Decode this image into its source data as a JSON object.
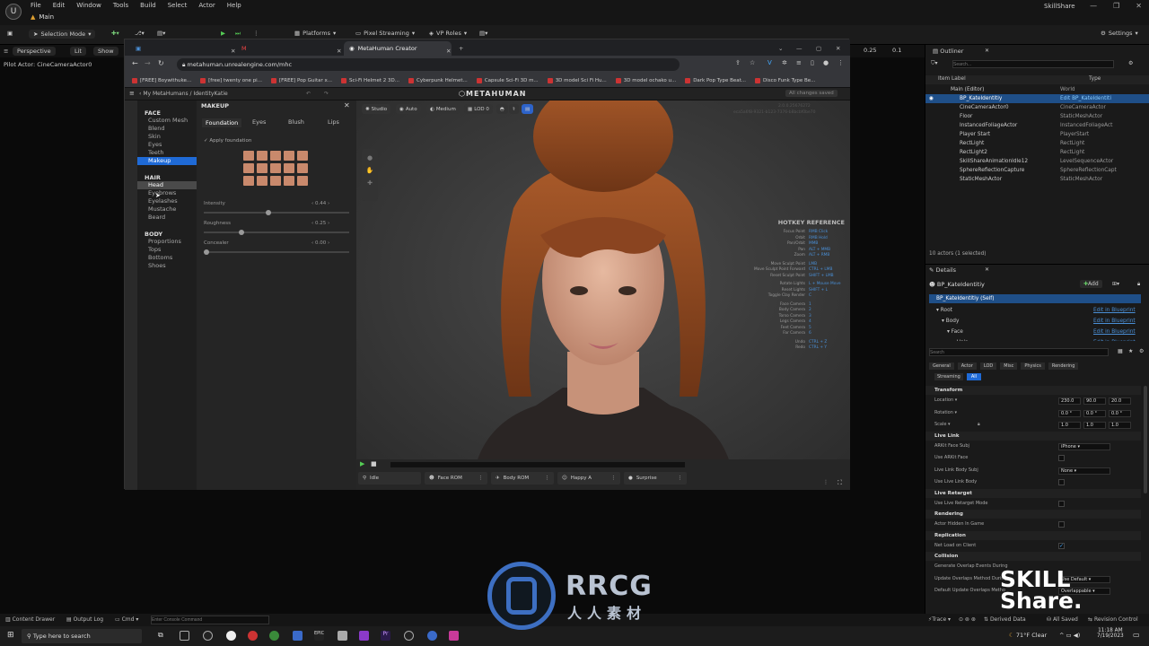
{
  "ue": {
    "menus": [
      "File",
      "Edit",
      "Window",
      "Tools",
      "Build",
      "Select",
      "Actor",
      "Help"
    ],
    "main_tab": "Main",
    "project": "SkillShare",
    "selection_mode": "Selection Mode",
    "platforms": "Platforms",
    "pixel_streaming": "Pixel Streaming",
    "vp_roles": "VP Roles",
    "settings": "Settings",
    "perspective": "Perspective",
    "lit": "Lit",
    "show": "Show",
    "pilot_actor": "Pilot Actor: CineCameraActor0",
    "vp_value1": "0.25",
    "vp_value2": "0.1"
  },
  "browser": {
    "tab_active": "MetaHuman Creator",
    "url": "metahuman.unrealengine.com/mhc",
    "bookmarks": [
      "[FREE] Boywithuke...",
      "[free] twenty one pi...",
      "[FREE] Pop Guitar x...",
      "Sci-Fi Helmet 2 3D...",
      "Cyberpunk Helmet...",
      "Capsule Sci-Fi 3D m...",
      "3D model Sci Fi Hu...",
      "3D model ochako u...",
      "Dark Pop Type Beat...",
      "Disco Funk Type Be..."
    ]
  },
  "mh": {
    "breadcrumb": "My MetaHumans / IdentityKatie",
    "logo": "METAHUMAN",
    "save_status": "All changes saved",
    "version": "2.0.0.25676272",
    "build_id": "eca5a6f8-9321-b123-7376-b8bcbf0be70",
    "nav": {
      "face_header": "FACE",
      "face": [
        "Custom Mesh",
        "Blend",
        "Skin",
        "Eyes",
        "Teeth",
        "Makeup"
      ],
      "hair_header": "HAIR",
      "hair": [
        "Head",
        "Eyebrows",
        "Eyelashes",
        "Mustache",
        "Beard"
      ],
      "body_header": "BODY",
      "body": [
        "Proportions",
        "Tops",
        "Bottoms",
        "Shoes"
      ]
    },
    "makeup": {
      "title": "MAKEUP",
      "tabs": [
        "Foundation",
        "Eyes",
        "Blush",
        "Lips"
      ],
      "apply": "Apply foundation",
      "sliders": [
        {
          "label": "Intensity",
          "value": "0.44",
          "fraction": 0.44
        },
        {
          "label": "Roughness",
          "value": "0.25",
          "fraction": 0.25
        },
        {
          "label": "Concealer",
          "value": "0.00",
          "fraction": 0.0
        }
      ]
    },
    "viewport_chips": [
      "Studio",
      "Auto",
      "Medium",
      "LOD 0"
    ],
    "hotkey_title": "HOTKEY REFERENCE",
    "hotkeys": [
      [
        "Focus Point",
        "RMB Click"
      ],
      [
        "Orbit",
        "RMB Hold"
      ],
      [
        "Pan/Orbit",
        "MMB"
      ],
      [
        "Pan",
        "ALT + MMB"
      ],
      [
        "Zoom",
        "ALT + RMB"
      ],
      [
        "Move Sculpt Point",
        "LMB"
      ],
      [
        "Move Sculpt Point Forward",
        "CTRL + LMB"
      ],
      [
        "Reset Sculpt Point",
        "SHIFT + LMB"
      ],
      [
        "Rotate Lights",
        "L + Mouse Move"
      ],
      [
        "Reset Lights",
        "SHIFT + L"
      ],
      [
        "Toggle Clay Render",
        "C"
      ],
      [
        "Face Camera",
        "1"
      ],
      [
        "Body Camera",
        "2"
      ],
      [
        "Torso Camera",
        "3"
      ],
      [
        "Legs Camera",
        "4"
      ],
      [
        "Feet Camera",
        "5"
      ],
      [
        "Far Camera",
        "6"
      ],
      [
        "Undo",
        "CTRL + Z"
      ],
      [
        "Redo",
        "CTRL + Y"
      ]
    ],
    "anims": [
      "Idle",
      "Face ROM",
      "Body ROM",
      "Happy A",
      "Surprise"
    ]
  },
  "outliner": {
    "title": "Outliner",
    "search_placeholder": "Search...",
    "col_label": "Item Label",
    "col_type": "Type",
    "rows": [
      [
        "Main (Editor)",
        "World"
      ],
      [
        "BP_KateIdentitiy",
        "Edit BP_KateIdentiti"
      ],
      [
        "CineCameraActor0",
        "CineCameraActor"
      ],
      [
        "Floor",
        "StaticMeshActor"
      ],
      [
        "InstancedFoliageActor",
        "InstancedFoliageAct"
      ],
      [
        "Player Start",
        "PlayerStart"
      ],
      [
        "RectLight",
        "RectLight"
      ],
      [
        "RectLight2",
        "RectLight"
      ],
      [
        "SkillShareAnimationIdle12",
        "LevelSequenceActor"
      ],
      [
        "SphereReflectionCapture",
        "SphereReflectionCapt"
      ],
      [
        "StaticMeshActor",
        "StaticMeshActor"
      ]
    ],
    "count": "10 actors (1 selected)"
  },
  "details": {
    "title": "Details",
    "actor": "BP_KateIdentitiy",
    "add": "Add",
    "self": "BP_KateIdentitiy (Self)",
    "components": [
      [
        "Root",
        "Edit in Blueprint"
      ],
      [
        "Body",
        "Edit in Blueprint"
      ],
      [
        "Face",
        "Edit in Blueprint"
      ],
      [
        "Hair",
        "Edit in Blueprint"
      ]
    ],
    "search_placeholder": "Search",
    "filters": [
      "General",
      "Actor",
      "LOD",
      "Misc",
      "Physics",
      "Rendering"
    ],
    "filters2": [
      "Streaming",
      "All"
    ],
    "transform": "Transform",
    "location": "Location",
    "location_vals": [
      "230.0",
      "90.0",
      "20.0"
    ],
    "rotation": "Rotation",
    "rotation_vals": [
      "0.0 °",
      "0.0 °",
      "0.0 °"
    ],
    "scale": "Scale",
    "scale_vals": [
      "1.0",
      "1.0",
      "1.0"
    ],
    "live_link": "Live Link",
    "arkit_face_subj": "ARKit Face Subj",
    "arkit_face_val": "iPhone",
    "use_arkit_face": "Use ARKit Face",
    "live_link_body_subj": "Live Link Body Subj",
    "live_link_body_val": "None",
    "use_live_link_body": "Use Live Link Body",
    "live_retarget": "Live Retarget",
    "use_live_retarget": "Use Live Retarget Mode",
    "rendering": "Rendering",
    "actor_hidden": "Actor Hidden In Game",
    "replication": "Replication",
    "net_load": "Net Load on Client",
    "collision": "Collision",
    "generate_overlap": "Generate Overlap Events During",
    "update_overlaps": "Update Overlaps Method During",
    "update_overlaps_val": "Use Default",
    "default_update": "Default Update Overlaps Metho",
    "default_update_val": "Overlappable"
  },
  "bottom": {
    "content_drawer": "Content Drawer",
    "output_log": "Output Log",
    "cmd": "Cmd",
    "console_placeholder": "Enter Console Command",
    "trace": "Trace",
    "derived_data": "Derived Data",
    "all_saved": "All Saved",
    "revision_control": "Revision Control"
  },
  "taskbar": {
    "search": "Type here to search",
    "weather": "71°F  Clear",
    "time": "11:18 AM",
    "date": "7/19/2023"
  },
  "watermark": {
    "rrcg": "RRCG",
    "rrcg_sub": "人人素材",
    "skill": "SKILL",
    "share": "Share."
  },
  "colors": {
    "accent_blue": "#1f6ad6",
    "ue_bg": "#1a1a1a",
    "hotkey_value": "#4a8fd6",
    "swatch": "#c9896c"
  }
}
